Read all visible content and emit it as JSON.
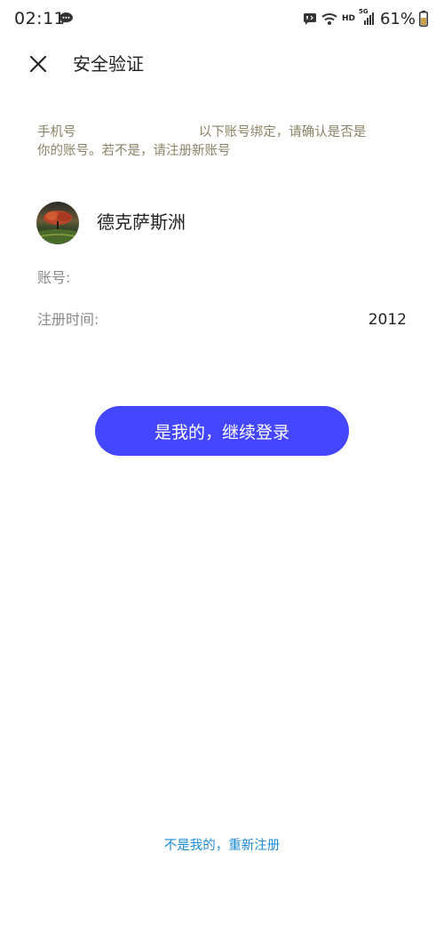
{
  "status_bar": {
    "time": "02:11",
    "network_label": "HD",
    "signal_label": "5G",
    "battery_percent": "61%",
    "icons": [
      "chat-bubble-icon",
      "message-icon",
      "wifi-icon",
      "signal-icon",
      "battery-icon"
    ]
  },
  "header": {
    "close_icon": "close-icon",
    "title": "安全验证"
  },
  "notice": {
    "line1": "手机号                              以下账号绑定，请确认是否是",
    "line2": "你的账号。若不是，请注册新账号"
  },
  "account": {
    "avatar_icon": "avatar-image",
    "nickname": "德克萨斯洲",
    "account_label": "账号:",
    "account_value": "",
    "register_label": "注册时间:",
    "register_value": "2012"
  },
  "actions": {
    "confirm_label": "是我的，继续登录",
    "reregister_label": "不是我的，重新注册"
  },
  "colors": {
    "primary": "#4447ff",
    "link": "#1d8ad6",
    "notice_text": "#8a8466",
    "label_text": "#888888"
  }
}
